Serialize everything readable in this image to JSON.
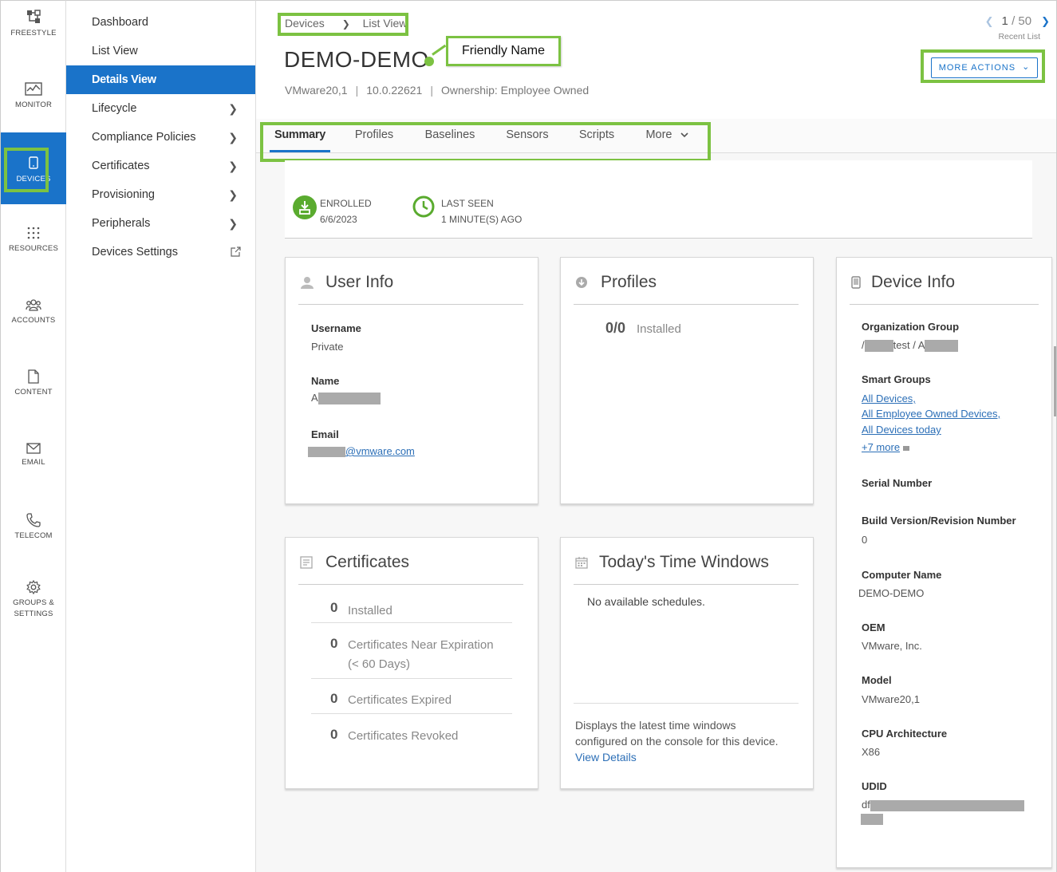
{
  "rail": [
    {
      "label": "FREESTYLE",
      "icon": "freestyle-icon"
    },
    {
      "label": "MONITOR",
      "icon": "monitor-icon"
    },
    {
      "label": "DEVICES",
      "icon": "devices-icon"
    },
    {
      "label": "RESOURCES",
      "icon": "resources-icon"
    },
    {
      "label": "ACCOUNTS",
      "icon": "accounts-icon"
    },
    {
      "label": "CONTENT",
      "icon": "content-icon"
    },
    {
      "label": "EMAIL",
      "icon": "email-icon"
    },
    {
      "label": "TELECOM",
      "icon": "telecom-icon"
    },
    {
      "label": "GROUPS &",
      "label2": "SETTINGS",
      "icon": "gear-icon"
    }
  ],
  "subnav": [
    {
      "label": "Dashboard"
    },
    {
      "label": "List View"
    },
    {
      "label": "Details View"
    },
    {
      "label": "Lifecycle"
    },
    {
      "label": "Compliance Policies"
    },
    {
      "label": "Certificates"
    },
    {
      "label": "Provisioning"
    },
    {
      "label": "Peripherals"
    },
    {
      "label": "Devices Settings"
    }
  ],
  "breadcrumb": {
    "root": "Devices",
    "current": "List View"
  },
  "device": {
    "title": "DEMO-DEMO",
    "model": "VMware20,1",
    "os": "10.0.22621",
    "ownership": "Ownership: Employee Owned"
  },
  "callout": {
    "text": "Friendly Name"
  },
  "pager": {
    "current": "1",
    "total": "/ 50",
    "label": "Recent List"
  },
  "more_actions": {
    "label": "MORE ACTIONS"
  },
  "tabs": [
    "Summary",
    "Profiles",
    "Baselines",
    "Sensors",
    "Scripts",
    "More"
  ],
  "status": {
    "enrolled_label": "ENROLLED",
    "enrolled_value": "6/6/2023",
    "last_seen_label": "LAST SEEN",
    "last_seen_value": "1 MINUTE(S) AGO"
  },
  "user_info": {
    "title": "User Info",
    "username_label": "Username",
    "username_value": "Private",
    "name_label": "Name",
    "name_prefix": "A",
    "email_label": "Email",
    "email_suffix": "@vmware.com"
  },
  "profiles": {
    "title": "Profiles",
    "count": "0/0",
    "count_label": "Installed"
  },
  "certificates": {
    "title": "Certificates",
    "rows": [
      {
        "n": "0",
        "label": "Installed"
      },
      {
        "n": "0",
        "label": "Certificates Near Expiration",
        "label2": "(< 60 Days)"
      },
      {
        "n": "0",
        "label": "Certificates Expired"
      },
      {
        "n": "0",
        "label": "Certificates Revoked"
      }
    ]
  },
  "time_windows": {
    "title": "Today's Time Windows",
    "empty": "No available schedules.",
    "footer1": "Displays the latest time windows",
    "footer2": "configured on the console for this device.",
    "link": "View Details"
  },
  "device_info": {
    "title": "Device Info",
    "org_group_label": "Organization Group",
    "org_group_prefix": "/",
    "org_group_mid": "test / A",
    "smart_groups_label": "Smart Groups",
    "smart_groups": [
      "All Devices,",
      "All Employee Owned Devices,",
      "All Devices today"
    ],
    "smart_groups_more": "+7 more",
    "serial_label": "Serial Number",
    "build_label": "Build Version/Revision Number",
    "build_value": "0",
    "computer_name_label": "Computer Name",
    "computer_name_value": "DEMO-DEMO",
    "oem_label": "OEM",
    "oem_value": "VMware, Inc.",
    "model_label": "Model",
    "model_value": "VMware20,1",
    "cpu_label": "CPU Architecture",
    "cpu_value": "X86",
    "udid_label": "UDID",
    "udid_prefix": "df"
  },
  "colors": {
    "accent": "#1a73c9",
    "highlight": "#7cc242",
    "status_green": "#5aab2f"
  }
}
